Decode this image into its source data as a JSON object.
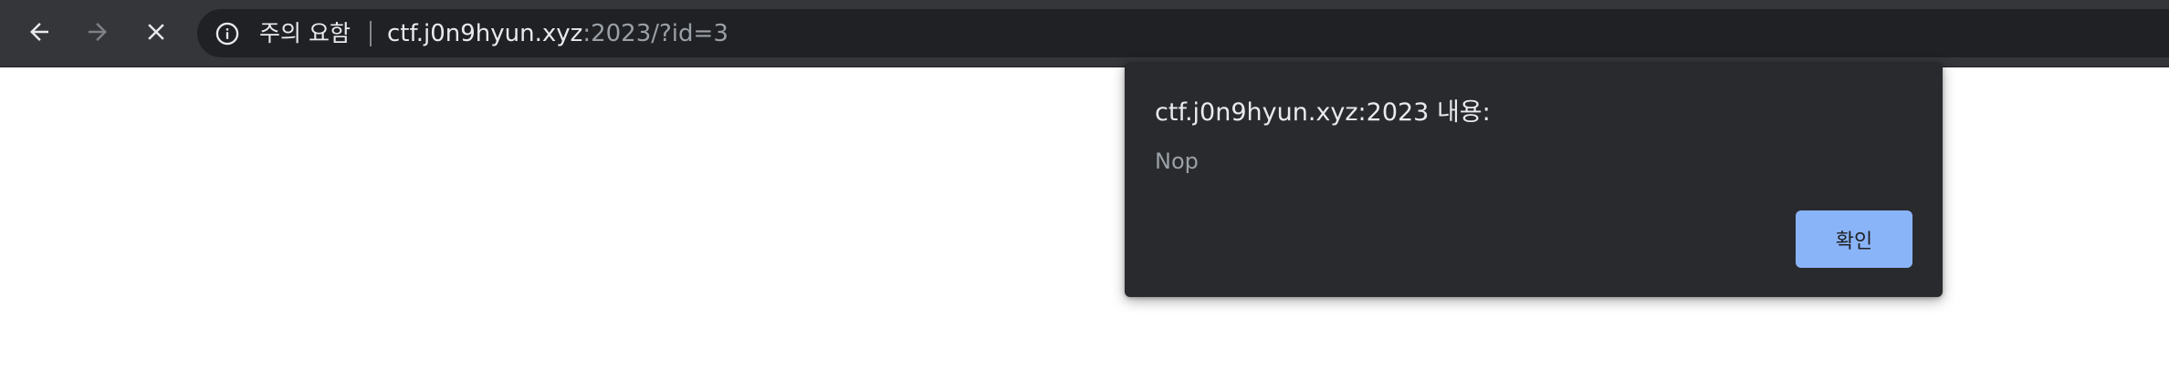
{
  "browser": {
    "nav": {
      "back_icon": "arrow-left-icon",
      "forward_icon": "arrow-right-icon",
      "stop_icon": "close-icon"
    },
    "omnibox": {
      "security_icon": "info-icon",
      "security_label": "주의 요함",
      "url_host": "ctf.j0n9hyun.xyz",
      "url_rest": ":2023/?id=3"
    }
  },
  "alert_dialog": {
    "title": "ctf.j0n9hyun.xyz:2023 내용:",
    "message": "Nop",
    "ok_label": "확인"
  },
  "colors": {
    "toolbar": "#35363a",
    "omnibox": "#202124",
    "dialog": "#292a2d",
    "ok_button": "#8ab4f8",
    "page": "#ffffff"
  }
}
